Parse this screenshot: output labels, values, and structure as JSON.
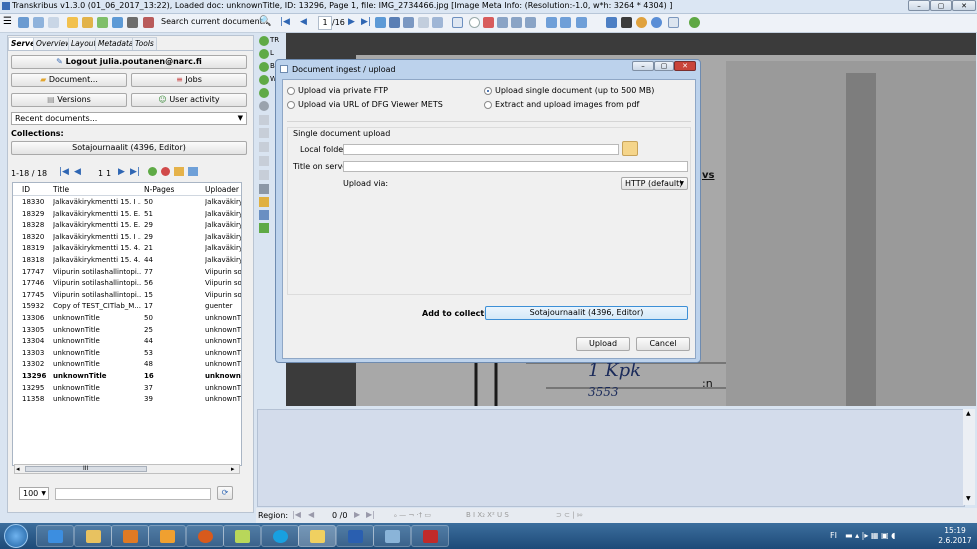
{
  "window": {
    "title": "Transkribus v1.3.0 (01_06_2017_13:22), Loaded doc: unknownTitle, ID: 13296, Page 1, file: IMG_2734466.jpg [Image Meta Info: (Resolution:-1.0, w*h: 3264 * 4304) ]",
    "min_label": "–",
    "max_label": "▢",
    "close_label": "✕"
  },
  "toolbar": {
    "search_label": "Search current document...",
    "page_value": "1",
    "page_total": "/16"
  },
  "left": {
    "tabs": [
      "Server",
      "Overview",
      "Layout",
      "Metadata",
      "Tools"
    ],
    "logout_label": "Logout julia.poutanen@narc.fi",
    "document_label": "Document...",
    "jobs_label": "Jobs",
    "versions_label": "Versions",
    "user_activity_label": "User activity",
    "recent_label": "Recent documents...",
    "collections_label": "Collections:",
    "collection_value": "Sotajournaalit (4396, Editor)",
    "pager_text": "1-18 / 18",
    "pager_page": "1",
    "pager_total": "1",
    "columns": [
      "ID",
      "Title",
      "N-Pages",
      "Uploader"
    ],
    "rows": [
      {
        "id": "18330",
        "title": "Jalkaväkirykmentti 15. I ...",
        "pages": "50",
        "uploader": "Jalkaväkiry"
      },
      {
        "id": "18329",
        "title": "Jalkaväkirykmentti 15. E...",
        "pages": "51",
        "uploader": "Jalkaväkiry"
      },
      {
        "id": "18328",
        "title": "Jalkaväkirykmentti 15. E...",
        "pages": "29",
        "uploader": "Jalkaväkiry"
      },
      {
        "id": "18320",
        "title": "Jalkaväkirykmentti 15. I ...",
        "pages": "29",
        "uploader": "Jalkaväkiry"
      },
      {
        "id": "18319",
        "title": "Jalkaväkirykmentti 15. 4....",
        "pages": "21",
        "uploader": "Jalkaväkiry"
      },
      {
        "id": "18318",
        "title": "Jalkaväkirykmentti 15. 4....",
        "pages": "44",
        "uploader": "Jalkaväkiry"
      },
      {
        "id": "17747",
        "title": "Viipurin sotilashallintopi...",
        "pages": "77",
        "uploader": "Viipurin so"
      },
      {
        "id": "17746",
        "title": "Viipurin sotilashallintopi...",
        "pages": "56",
        "uploader": "Viipurin so"
      },
      {
        "id": "17745",
        "title": "Viipurin sotilashallintopi...",
        "pages": "15",
        "uploader": "Viipurin so"
      },
      {
        "id": "15932",
        "title": "Copy of TEST_CITlab_M...",
        "pages": "17",
        "uploader": "guenter"
      },
      {
        "id": "13306",
        "title": "unknownTitle",
        "pages": "50",
        "uploader": "unknownT"
      },
      {
        "id": "13305",
        "title": "unknownTitle",
        "pages": "25",
        "uploader": "unknownT"
      },
      {
        "id": "13304",
        "title": "unknownTitle",
        "pages": "44",
        "uploader": "unknownT"
      },
      {
        "id": "13303",
        "title": "unknownTitle",
        "pages": "53",
        "uploader": "unknownT"
      },
      {
        "id": "13302",
        "title": "unknownTitle",
        "pages": "48",
        "uploader": "unknownT"
      },
      {
        "id": "13296",
        "title": "unknownTitle",
        "pages": "16",
        "uploader": "unknownT",
        "selected": true
      },
      {
        "id": "13295",
        "title": "unknownTitle",
        "pages": "37",
        "uploader": "unknownT"
      },
      {
        "id": "11358",
        "title": "unknownTitle",
        "pages": "39",
        "uploader": "unknownT"
      }
    ],
    "scroll_label": "III",
    "page_size": "100"
  },
  "strip": [
    "TR",
    "L",
    "B",
    "W"
  ],
  "page_image": {
    "stamp_text": "1 Kpk",
    "stamp_number": "3553",
    "fragment": "vs",
    "fragment2": ":n"
  },
  "dialog": {
    "title": "Document ingest / upload",
    "option_ftp": "Upload via private FTP",
    "option_single": "Upload single document (up to 500 MB)",
    "option_mets": "Upload via URL of DFG Viewer METS",
    "option_pdf": "Extract and upload images from pdf",
    "group_label": "Single document upload",
    "local_folder_label": "Local folder:",
    "title_on_server_label": "Title on server:",
    "upload_via_label": "Upload via:",
    "upload_via_value": "HTTP (default)",
    "add_to_collection_label": "Add to collection:",
    "collection_value": "Sotajournaalit (4396, Editor)",
    "upload_label": "Upload",
    "cancel_label": "Cancel"
  },
  "regionbar": {
    "label": "Region:",
    "page": "0 /0",
    "format": "B  I  X₂  X²  U  S"
  },
  "taskbar": {
    "time": "15:19",
    "date": "2.6.2017",
    "lang": "FI"
  },
  "colors": {
    "accent": "#3a6cb5",
    "dialog_frame": "#bcd2ec",
    "close_red": "#c9443a",
    "taskbar": "#2a5a8a"
  }
}
